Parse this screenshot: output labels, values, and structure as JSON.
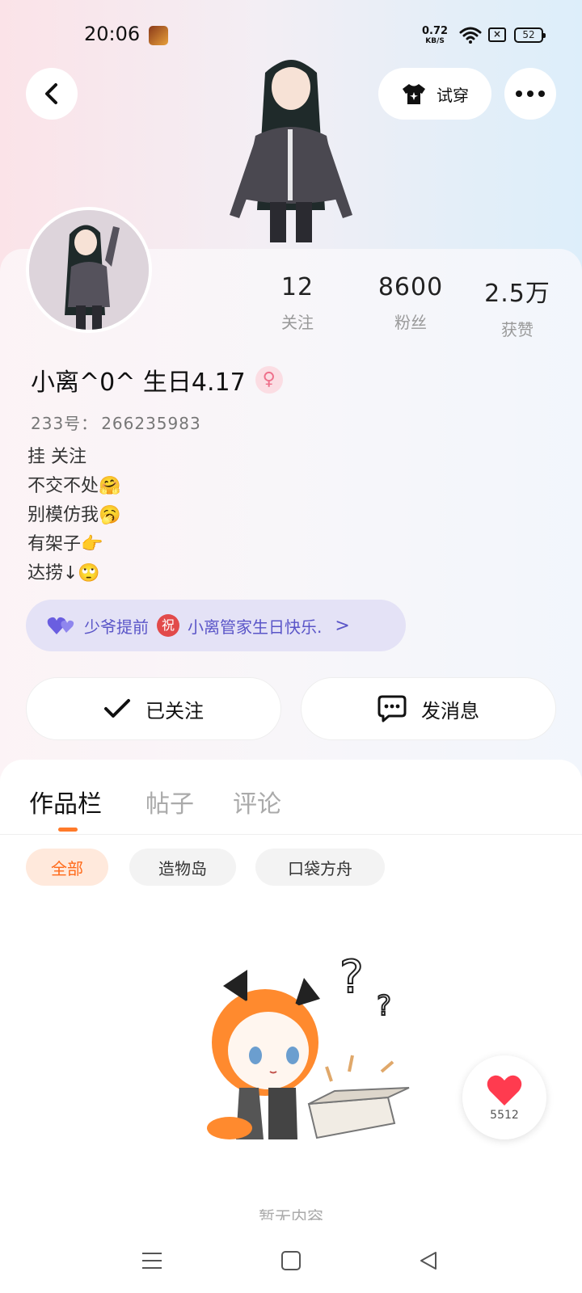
{
  "status_bar": {
    "time": "20:06",
    "net_speed_value": "0.72",
    "net_speed_unit": "KB/S",
    "battery": "52"
  },
  "header": {
    "try_on_label": "试穿"
  },
  "profile": {
    "stats": [
      {
        "value": "12",
        "label": "关注"
      },
      {
        "value": "8600",
        "label": "粉丝"
      },
      {
        "value": "2.5万",
        "label": "获赞"
      }
    ],
    "nickname": "小离^0^ 生日4.17",
    "gender_symbol": "♀",
    "uid_label": "233号：",
    "uid_value": "266235983",
    "bio": [
      "挂 关注",
      "不交不处🤗",
      "别模仿我🥱",
      "有架子👉",
      "达捞↓🙄"
    ],
    "greeting_before": "少爷提前",
    "greeting_badge": "祝",
    "greeting_after": "小离管家生日快乐.",
    "greeting_chevron": ">"
  },
  "actions": {
    "followed_label": "已关注",
    "message_label": "发消息"
  },
  "tabs": [
    {
      "label": "作品栏",
      "active": true
    },
    {
      "label": "帖子",
      "active": false
    },
    {
      "label": "评论",
      "active": false
    }
  ],
  "filters": [
    {
      "label": "全部",
      "active": true
    },
    {
      "label": "造物岛",
      "active": false
    },
    {
      "label": "口袋方舟",
      "active": false
    }
  ],
  "empty_state_text": "暂无内容",
  "like_fab": {
    "count": "5512"
  },
  "colors": {
    "accent": "#ff7a2a",
    "greeting": "#5a55c8",
    "heart": "#ff3b4f"
  }
}
